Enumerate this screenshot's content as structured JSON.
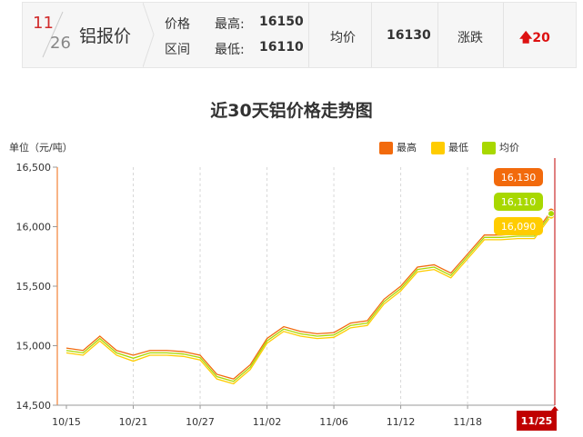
{
  "header": {
    "month": "11",
    "day": "26",
    "metal": "铝报价",
    "price_label": "价格",
    "range_label": "区间",
    "high_label": "最高:",
    "high_value": "16150",
    "low_label": "最低:",
    "low_value": "16110",
    "avg_label": "均价",
    "avg_value": "16130",
    "change_label": "涨跌",
    "change_value": "20",
    "colors": {
      "up": "#d11111",
      "month": "#d12b2b"
    }
  },
  "chart_data": {
    "type": "line",
    "title": "近30天铝价格走势图",
    "ylabel": "单位（元/吨）",
    "ylim": [
      14500,
      16500
    ],
    "yticks": [
      14500,
      15000,
      15500,
      16000,
      16500
    ],
    "ytick_labels": [
      "14,500",
      "15,000",
      "15,500",
      "16,000",
      "16,500"
    ],
    "x": [
      "10/15",
      "10/16",
      "10/17",
      "10/18",
      "10/21",
      "10/22",
      "10/23",
      "10/24",
      "10/25",
      "10/28",
      "10/29",
      "10/30",
      "10/31",
      "11/01",
      "11/04",
      "11/05",
      "11/06",
      "11/07",
      "11/08",
      "11/11",
      "11/12",
      "11/13",
      "11/14",
      "11/15",
      "11/18",
      "11/19",
      "11/20",
      "11/21",
      "11/22",
      "11/25"
    ],
    "xtick_labels": [
      "10/15",
      "10/21",
      "10/27",
      "11/02",
      "11/06",
      "11/12",
      "11/18",
      "11/25"
    ],
    "xtick_index": [
      0,
      4,
      8,
      12,
      16,
      20,
      24,
      29
    ],
    "series": [
      {
        "name": "最高",
        "color": "#f26a0c",
        "values": [
          14980,
          14960,
          15080,
          14960,
          14920,
          14960,
          14960,
          14950,
          14920,
          14760,
          14720,
          14840,
          15060,
          15160,
          15120,
          15100,
          15110,
          15190,
          15210,
          15390,
          15500,
          15660,
          15680,
          15610,
          15770,
          15930,
          15930,
          15940,
          15940,
          16130
        ]
      },
      {
        "name": "最低",
        "color": "#ffcc00",
        "values": [
          14940,
          14920,
          15040,
          14920,
          14870,
          14920,
          14920,
          14910,
          14880,
          14720,
          14680,
          14800,
          15020,
          15120,
          15080,
          15060,
          15070,
          15150,
          15170,
          15350,
          15460,
          15620,
          15640,
          15570,
          15730,
          15890,
          15890,
          15900,
          15900,
          16090
        ]
      },
      {
        "name": "均价",
        "color": "#a8d800",
        "values": [
          14960,
          14940,
          15060,
          14940,
          14895,
          14940,
          14940,
          14930,
          14900,
          14740,
          14700,
          14820,
          15040,
          15140,
          15100,
          15080,
          15090,
          15170,
          15190,
          15370,
          15480,
          15640,
          15660,
          15590,
          15750,
          15910,
          15910,
          15920,
          15920,
          16110
        ]
      }
    ],
    "tooltip_labels": [
      "16,130",
      "16,110",
      "16,090"
    ],
    "current_x_label": "11/25",
    "grid": true,
    "legend_position": "top-right"
  }
}
